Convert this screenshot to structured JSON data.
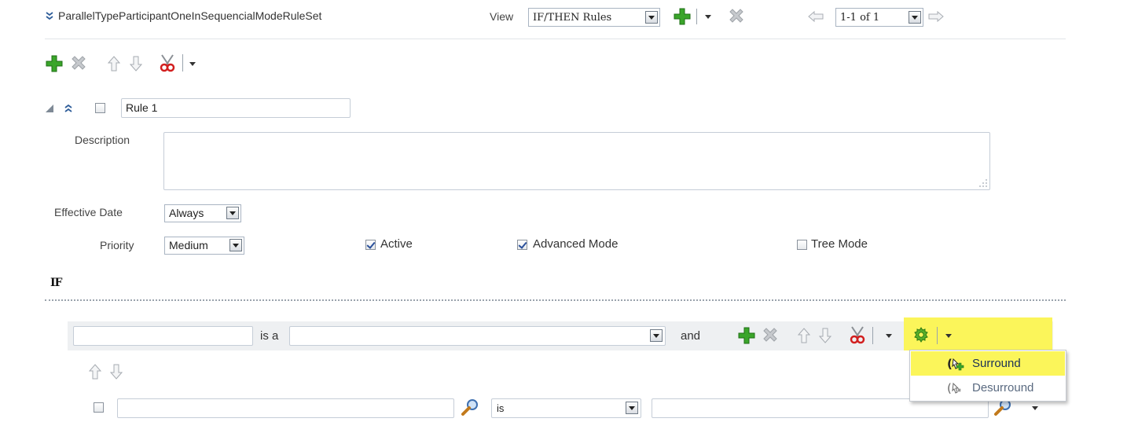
{
  "header": {
    "ruleset_name": "ParallelTypeParticipantOneInSequencialModeRuleSet",
    "view_label": "View",
    "view_value": "IF/THEN Rules",
    "pagination": "1-1 of 1"
  },
  "rule": {
    "name": "Rule 1",
    "description_label": "Description",
    "description_value": "",
    "effective_date_label": "Effective Date",
    "effective_date_value": "Always",
    "priority_label": "Priority",
    "priority_value": "Medium",
    "active_label": "Active",
    "active_checked": true,
    "advanced_mode_label": "Advanced Mode",
    "advanced_mode_checked": true,
    "tree_mode_label": "Tree Mode",
    "tree_mode_checked": false
  },
  "if_section": {
    "title": "IF",
    "pattern": {
      "variable_value": "",
      "is_a_label": "is a",
      "fact_type_value": "",
      "conjunction_label": "and"
    },
    "condition": {
      "left_value": "",
      "operator_value": "is",
      "right_value": ""
    }
  },
  "context_menu": {
    "items": [
      {
        "label": "Surround",
        "highlighted": true
      },
      {
        "label": "Desurround",
        "highlighted": false
      }
    ]
  },
  "colors": {
    "highlight_yellow": "#fbf55a",
    "menu_highlight": "#fbf55a",
    "add_green": "#3aa52a"
  }
}
